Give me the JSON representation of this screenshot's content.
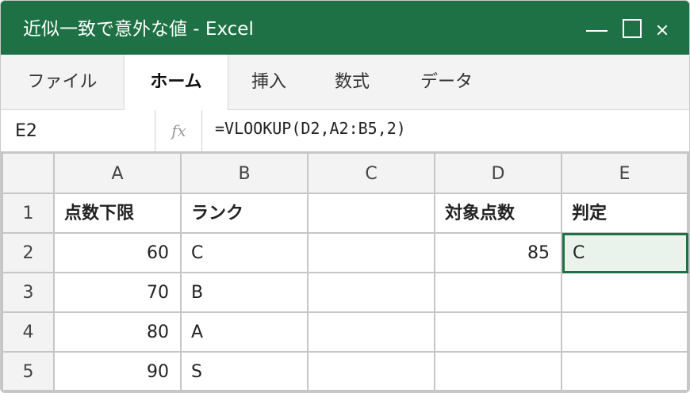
{
  "window": {
    "title": "近似一致で意外な値 - Excel",
    "accent_color": "#1e7145"
  },
  "ribbon": {
    "tabs": [
      {
        "label": "ファイル",
        "active": false
      },
      {
        "label": "ホーム",
        "active": true
      },
      {
        "label": "挿入",
        "active": false
      },
      {
        "label": "数式",
        "active": false
      },
      {
        "label": "データ",
        "active": false
      }
    ]
  },
  "formula_bar": {
    "name_box": "E2",
    "fx_label": "fx",
    "formula": "=VLOOKUP(D2,A2:B5,2)"
  },
  "sheet": {
    "columns": [
      "A",
      "B",
      "C",
      "D",
      "E"
    ],
    "rows": [
      "1",
      "2",
      "3",
      "4",
      "5"
    ],
    "cells": {
      "A1": "点数下限",
      "B1": "ランク",
      "C1": "",
      "D1": "対象点数",
      "E1": "判定",
      "A2": "60",
      "B2": "C",
      "C2": "",
      "D2": "85",
      "E2": "C",
      "A3": "70",
      "B3": "B",
      "C3": "",
      "D3": "",
      "E3": "",
      "A4": "80",
      "B4": "A",
      "C4": "",
      "D4": "",
      "E4": "",
      "A5": "90",
      "B5": "S",
      "C5": "",
      "D5": "",
      "E5": ""
    },
    "active_cell": "E2"
  }
}
